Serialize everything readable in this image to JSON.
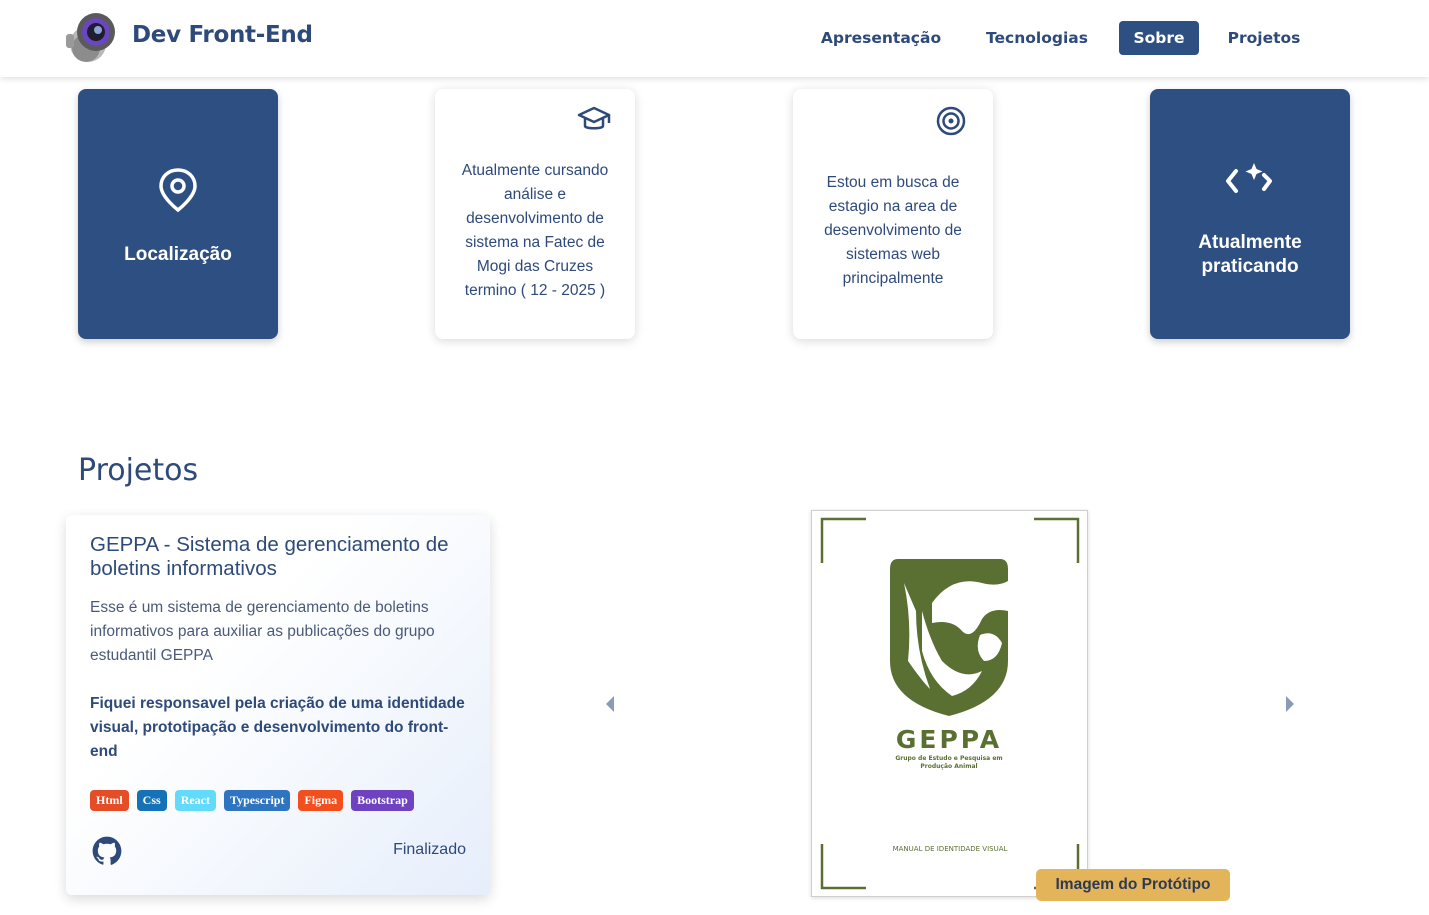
{
  "header": {
    "brand": "Dev Front-End",
    "nav": [
      {
        "label": "Apresentação",
        "active": false
      },
      {
        "label": "Tecnologias",
        "active": false
      },
      {
        "label": "Sobre",
        "active": true
      },
      {
        "label": "Projetos",
        "active": false
      }
    ]
  },
  "cards": [
    {
      "icon": "location-pin-icon",
      "title": "Localização"
    },
    {
      "icon": "graduation-cap-icon",
      "text": "Atualmente cursando análise e desenvolvimento de sistema na Fatec de Mogi das Cruzes termino ( 12 - 2025 )"
    },
    {
      "icon": "target-icon",
      "text": "Estou em busca de estagio na area de desenvolvimento de sistemas web principalmente"
    },
    {
      "icon": "code-sparkle-icon",
      "title": "Atualmente praticando"
    }
  ],
  "projects": {
    "heading": "Projetos",
    "current": {
      "title": "GEPPA - Sistema de gerenciamento de boletins informativos",
      "description": "Esse é um sistema de gerenciamento de boletins informativos para auxiliar as publicações do grupo estudantil GEPPA",
      "responsibility": "Fiquei responsavel pela criação de uma identidade visual, prototipação e desenvolvimento do front-end",
      "tags": [
        {
          "label": "Html",
          "color": "#e44d26"
        },
        {
          "label": "Css",
          "color": "#1572b6"
        },
        {
          "label": "React",
          "color": "#61dafb"
        },
        {
          "label": "Typescript",
          "color": "#2f74c0"
        },
        {
          "label": "Figma",
          "color": "#f24e1e"
        },
        {
          "label": "Bootstrap",
          "color": "#6f42c1"
        }
      ],
      "status": "Finalizado",
      "prototype": {
        "logo_text": "GEPPA",
        "logo_subtitle_1": "Grupo de Estudo e Pesquisa em",
        "logo_subtitle_2": "Produção Animal",
        "footer": "MANUAL DE IDENTIDADE VISUAL",
        "badge": "Imagem do Protótipo"
      }
    }
  },
  "colors": {
    "primary": "#2e4f82",
    "text": "#2e4a7a",
    "geppa_green": "#5a7032",
    "badge": "#e4b45a"
  }
}
